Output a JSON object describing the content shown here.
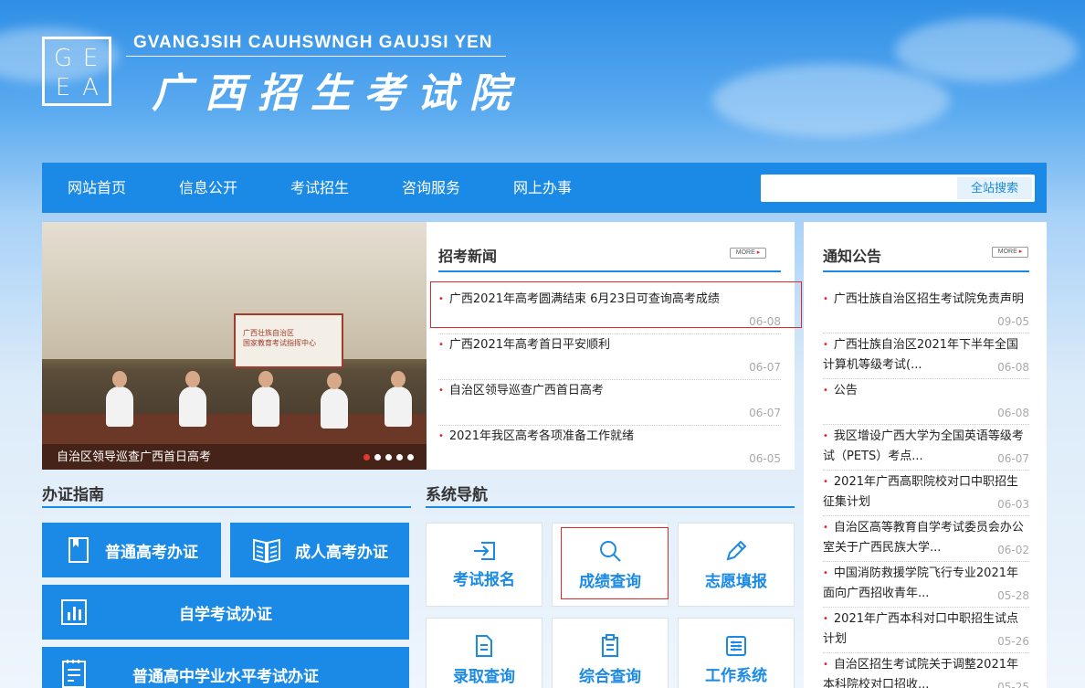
{
  "header": {
    "logo_letters": [
      "G",
      "E",
      "E",
      "A"
    ],
    "site_name_en": "GVANGJSIH CAUHSWNGH GAUJSI YEN",
    "site_name_cn": "广西招生考试院"
  },
  "nav": {
    "items": [
      {
        "label": "网站首页"
      },
      {
        "label": "信息公开"
      },
      {
        "label": "考试招生"
      },
      {
        "label": "咨询服务"
      },
      {
        "label": "网上办事"
      }
    ],
    "search_placeholder": "",
    "search_button": "全站搜索"
  },
  "slideshow": {
    "caption": "自治区领导巡查广西首日高考",
    "screen_text": "广西壮族自治区\n国家教育考试指挥中心",
    "dots": 5,
    "active_dot": 0
  },
  "news": {
    "title": "招考新闻",
    "more": "MORE",
    "items": [
      {
        "title": "广西2021年高考圆满结束 6月23日可查询高考成绩",
        "date": "06-08"
      },
      {
        "title": "广西2021年高考首日平安顺利",
        "date": "06-07"
      },
      {
        "title": "自治区领导巡查广西首日高考",
        "date": "06-07"
      },
      {
        "title": "2021年我区高考各项准备工作就绪",
        "date": "06-05"
      }
    ]
  },
  "notices": {
    "title": "通知公告",
    "more": "MORE",
    "items": [
      {
        "title": "广西壮族自治区招生考试院免责声明",
        "date": "09-05"
      },
      {
        "title": "广西壮族自治区2021年下半年全国计算机等级考试(...",
        "date": "06-08"
      },
      {
        "title": "公告",
        "date": "06-08"
      },
      {
        "title": "我区增设广西大学为全国英语等级考试（PETS）考点...",
        "date": "06-07"
      },
      {
        "title": "2021年广西高职院校对口中职招生征集计划",
        "date": "06-03"
      },
      {
        "title": "自治区高等教育自学考试委员会办公室关于广西民族大学...",
        "date": "06-02"
      },
      {
        "title": "中国消防救援学院飞行专业2021年面向广西招收青年...",
        "date": "05-28"
      },
      {
        "title": "2021年广西本科对口中职招生试点计划",
        "date": "05-26"
      },
      {
        "title": "自治区招生考试院关于调整2021年本科院校对口招收...",
        "date": "05-25"
      }
    ]
  },
  "guide": {
    "title": "办证指南",
    "buttons": [
      {
        "label": "普通高考办证"
      },
      {
        "label": "成人高考办证"
      },
      {
        "label": "自学考试办证"
      },
      {
        "label": "普通高中学业水平考试办证"
      }
    ]
  },
  "system": {
    "title": "系统导航",
    "cards": [
      {
        "label": "考试报名",
        "icon": "sign-in-icon"
      },
      {
        "label": "成绩查询",
        "icon": "search-icon"
      },
      {
        "label": "志愿填报",
        "icon": "pencil-icon"
      },
      {
        "label": "录取查询",
        "icon": "document-icon"
      },
      {
        "label": "综合查询",
        "icon": "clipboard-icon"
      },
      {
        "label": "工作系统",
        "icon": "settings-list-icon"
      }
    ]
  },
  "colors": {
    "brand_blue": "#1a8ae6",
    "highlight_red": "#e1292a",
    "bullet_red": "#dd2222"
  }
}
